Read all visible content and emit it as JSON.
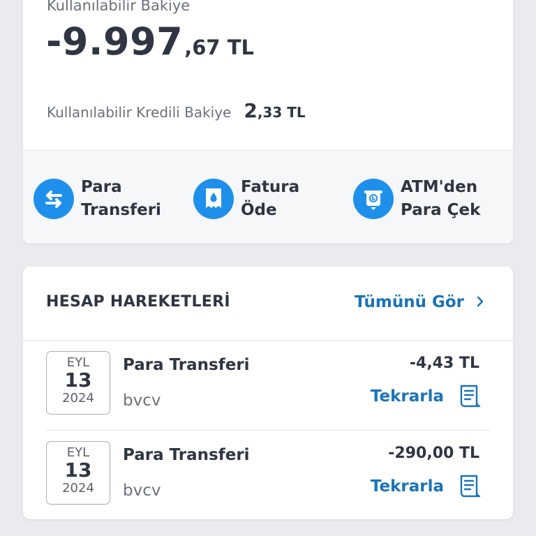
{
  "balance": {
    "label": "Kullanılabilir Bakiye",
    "amount_int": "-9.997",
    "amount_dec": ",67 TL",
    "credit_label": "Kullanılabilir Kredili Bakiye",
    "credit_int": "2",
    "credit_dec": ",33 TL"
  },
  "quick_actions": [
    {
      "line1": "Para",
      "line2": "Transferi",
      "icon": "transfer-arrows-icon"
    },
    {
      "line1": "Fatura",
      "line2": "Öde",
      "icon": "bill-icon"
    },
    {
      "line1": "ATM'den",
      "line2": "Para Çek",
      "icon": "atm-icon"
    }
  ],
  "transactions": {
    "title": "HESAP HAREKETLERİ",
    "see_all": "Tümünü Gör",
    "see_all_icon": "chevron-right-icon",
    "repeat_icon": "receipt-icon",
    "items": [
      {
        "month": "EYL",
        "day": "13",
        "year": "2024",
        "name": "Para Transferi",
        "description": "bvcv",
        "amount": "-4,43 TL",
        "repeat_label": "Tekrarla"
      },
      {
        "month": "EYL",
        "day": "13",
        "year": "2024",
        "name": "Para Transferi",
        "description": "bvcv",
        "amount": "-290,00 TL",
        "repeat_label": "Tekrarla"
      }
    ]
  },
  "colors": {
    "accent_blue": "#1e90ec",
    "link_blue": "#1a73b8",
    "background": "#e9ebef",
    "text_dark": "#2f3542"
  }
}
